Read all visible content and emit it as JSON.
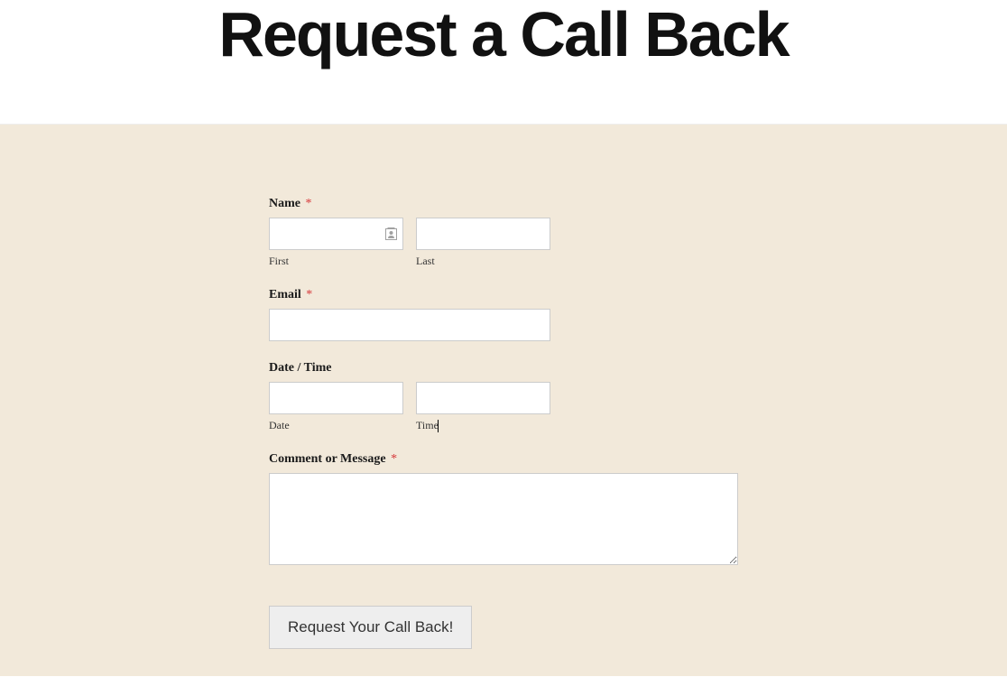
{
  "header": {
    "title": "Request a Call Back"
  },
  "form": {
    "name": {
      "label": "Name",
      "required": true,
      "first_sublabel": "First",
      "last_sublabel": "Last",
      "first_value": "",
      "last_value": ""
    },
    "email": {
      "label": "Email",
      "required": true,
      "value": ""
    },
    "datetime": {
      "label": "Date / Time",
      "required": false,
      "date_sublabel": "Date",
      "time_sublabel": "Time",
      "date_value": "",
      "time_value": ""
    },
    "comment": {
      "label": "Comment or Message",
      "required": true,
      "value": ""
    },
    "submit": {
      "label": "Request Your Call Back!"
    },
    "required_marker": "*"
  }
}
